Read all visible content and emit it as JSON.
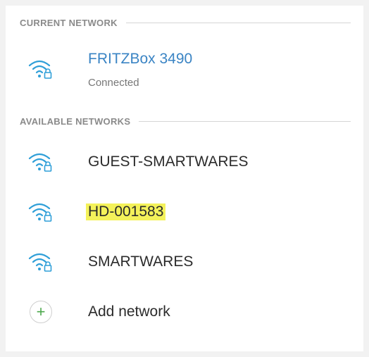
{
  "current_section": {
    "header": "CURRENT NETWORK",
    "network": {
      "name": "FRITZBox 3490",
      "status": "Connected",
      "icon": "wifi-lock-icon"
    }
  },
  "available_section": {
    "header": "AVAILABLE NETWORKS",
    "networks": [
      {
        "name": "GUEST-SMARTWARES",
        "icon": "wifi-lock-icon",
        "highlighted": false
      },
      {
        "name": "HD-001583",
        "icon": "wifi-lock-icon",
        "highlighted": true
      },
      {
        "name": "SMARTWARES",
        "icon": "wifi-lock-icon",
        "highlighted": false
      }
    ]
  },
  "add_network": {
    "label": "Add network",
    "icon": "plus-icon"
  },
  "colors": {
    "accent": "#3a84c4",
    "wifi_icon": "#2f9fd8",
    "highlight": "#f4f25a",
    "plus": "#4ca84c"
  }
}
